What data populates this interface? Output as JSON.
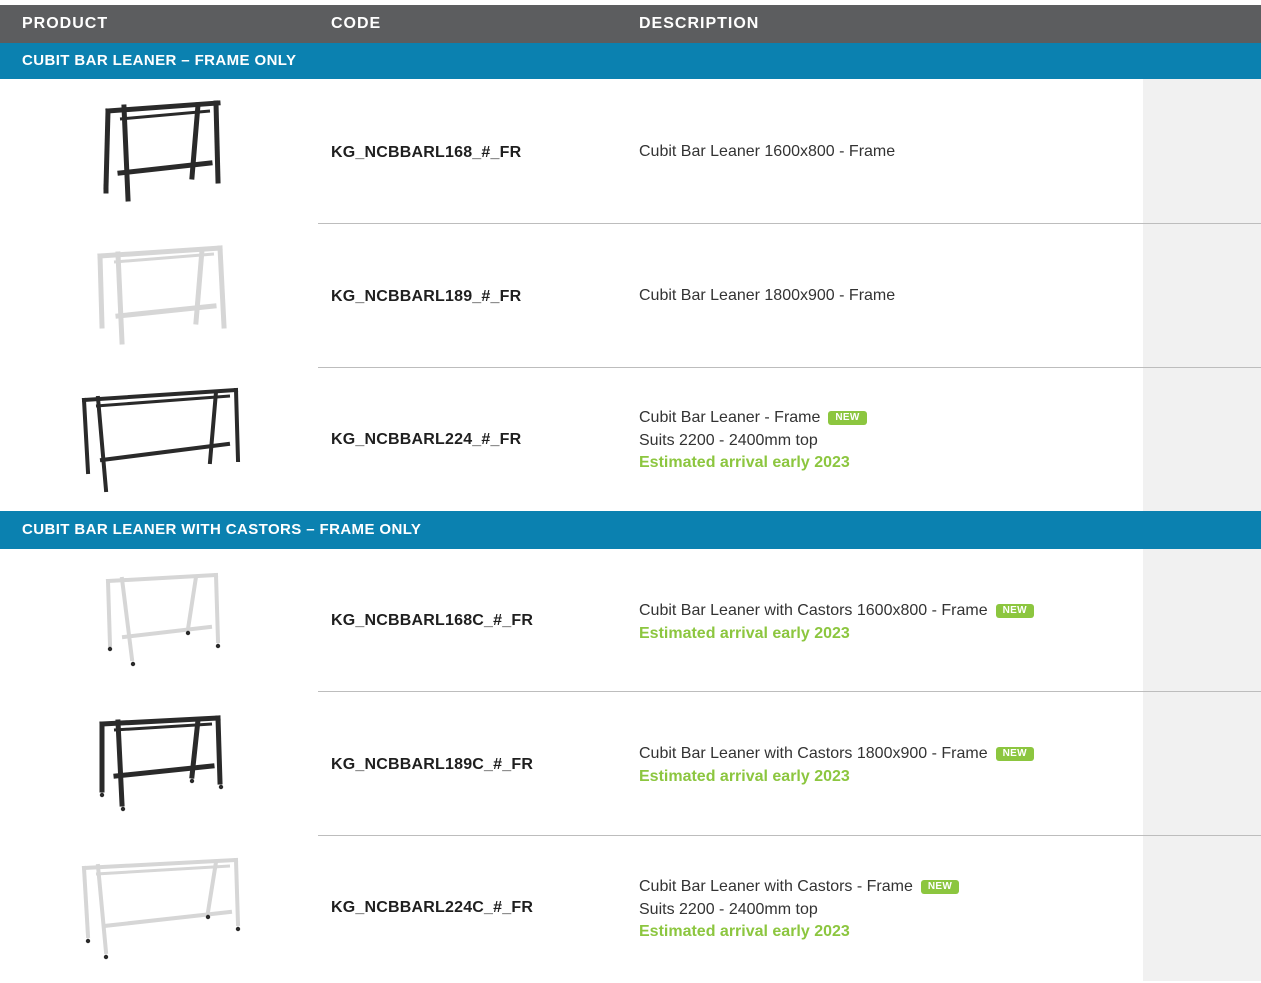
{
  "header": {
    "product": "PRODUCT",
    "code": "CODE",
    "description": "DESCRIPTION"
  },
  "accent_colors": {
    "header_bg": "#5c5d5f",
    "section_bg": "#0b81b0",
    "highlight_green": "#8cc63f"
  },
  "sections": [
    {
      "title": "CUBIT BAR LEANER – FRAME ONLY",
      "rows": [
        {
          "code": "KG_NCBBARL168_#_FR",
          "desc_line1": "Cubit Bar Leaner 1600x800 - Frame",
          "frame_color": "black"
        },
        {
          "code": "KG_NCBBARL189_#_FR",
          "desc_line1": "Cubit Bar Leaner 1800x900 - Frame",
          "frame_color": "white"
        },
        {
          "code": "KG_NCBBARL224_#_FR",
          "desc_line1": "Cubit Bar Leaner - Frame",
          "badge": "NEW",
          "desc_line2": "Suits 2200 - 2400mm top",
          "arrival": "Estimated arrival early 2023",
          "frame_color": "black"
        }
      ]
    },
    {
      "title": "CUBIT BAR LEANER WITH CASTORS – FRAME ONLY",
      "rows": [
        {
          "code": "KG_NCBBARL168C_#_FR",
          "desc_line1": "Cubit Bar Leaner with Castors 1600x800 - Frame",
          "badge": "NEW",
          "arrival": "Estimated arrival early 2023",
          "frame_color": "white"
        },
        {
          "code": "KG_NCBBARL189C_#_FR",
          "desc_line1": "Cubit Bar Leaner with Castors 1800x900 - Frame",
          "badge": "NEW",
          "arrival": "Estimated arrival early 2023",
          "frame_color": "black"
        },
        {
          "code": "KG_NCBBARL224C_#_FR",
          "desc_line1": "Cubit Bar Leaner with Castors - Frame",
          "badge": "NEW",
          "desc_line2": "Suits 2200 - 2400mm top",
          "arrival": "Estimated arrival early 2023",
          "frame_color": "white"
        }
      ]
    }
  ]
}
